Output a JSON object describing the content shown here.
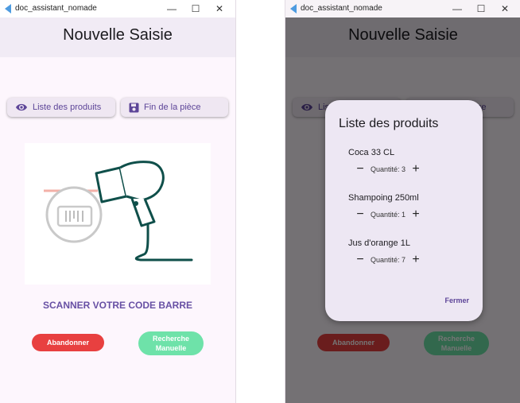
{
  "window": {
    "title": "doc_assistant_nomade",
    "controls": {
      "minimize": "—",
      "maximize": "☐",
      "close": "✕"
    }
  },
  "appbar": {
    "title": "Nouvelle Saisie"
  },
  "actions": {
    "produits_label": "Liste des produits",
    "fin_label": "Fin de la pièce"
  },
  "scanner": {
    "caption": "SCANNER VOTRE CODE BARRE"
  },
  "buttons": {
    "abandonner": "Abandonner",
    "recherche_line1": "Recherche",
    "recherche_line2": "Manuelle"
  },
  "dialog": {
    "title": "Liste des produits",
    "products": [
      {
        "name": "Coca 33 CL",
        "quantity_label": "Quantité: 3"
      },
      {
        "name": "Shampoing 250ml",
        "quantity_label": "Quantité: 1"
      },
      {
        "name": "Jus d'orange 1L",
        "quantity_label": "Quantité: 7"
      }
    ],
    "close_label": "Fermer",
    "minus": "−",
    "plus": "+"
  },
  "colors": {
    "accent": "#6750a4",
    "danger": "#e84040",
    "success": "#6ee2a9",
    "illustration": "#0f4f4a"
  },
  "icons": {
    "app": "flutter-icon",
    "produits": "eye-icon",
    "fin": "save-icon",
    "scanner": "barcode-scanner-icon"
  }
}
